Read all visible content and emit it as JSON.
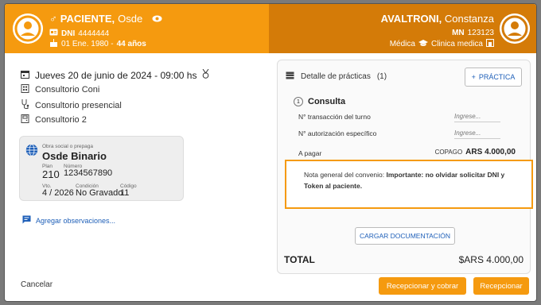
{
  "patient": {
    "name": "PACIENTE,",
    "insurer_short": "Osde",
    "dni_label": "DNI",
    "dni": "4444444",
    "birth": "01 Ene. 1980 -",
    "age": "44 años"
  },
  "doctor": {
    "surname": "AVALTRONI,",
    "first_name": "Constanza",
    "license_label": "MN",
    "license": "123123",
    "role": "Médica",
    "clinic": "Clinica medica"
  },
  "appointment": {
    "datetime": "Jueves 20 de junio de 2024 - 09:00 hs",
    "office": "Consultorio Coni",
    "mode": "Consultorio presencial",
    "room": "Consultorio 2"
  },
  "insurance_card": {
    "caption": "Obra social o prepaga",
    "name": "Osde Binario",
    "plan_label": "Plan",
    "plan": "210",
    "number_label": "Número",
    "number": "1234567890",
    "expiry_label": "Vto.",
    "expiry": "4 / 2026",
    "condition_label": "Condición",
    "condition": "No Gravado",
    "code_label": "Código",
    "code": "11"
  },
  "add_observations": "Agregar observaciones...",
  "practices": {
    "title": "Detalle de prácticas",
    "count": "(1)",
    "add_button": "PRÁCTICA",
    "item_number": "1",
    "item_name": "Consulta",
    "field_transaction": "N° transacción del turno",
    "field_authorization": "N° autorización específico",
    "input_placeholder": "Ingrese...",
    "to_pay_label": "A pagar",
    "copay_label": "COPAGO",
    "copay_amount": "ARS 4.000,00",
    "note_prefix": "Nota general del convenio:",
    "note_bold": "Importante: no olvidar solicitar DNI y Token al paciente.",
    "upload_button": "CARGAR DOCUMENTACIÓN",
    "total_label": "TOTAL",
    "total_value": "$ARS 4.000,00"
  },
  "footer": {
    "cancel": "Cancelar",
    "receive_and_charge": "Recepcionar y cobrar",
    "receive": "Recepcionar"
  },
  "colors": {
    "header_left": "#f59a0f",
    "header_right": "#d47b08",
    "accent_blue": "#1e5fb8"
  }
}
